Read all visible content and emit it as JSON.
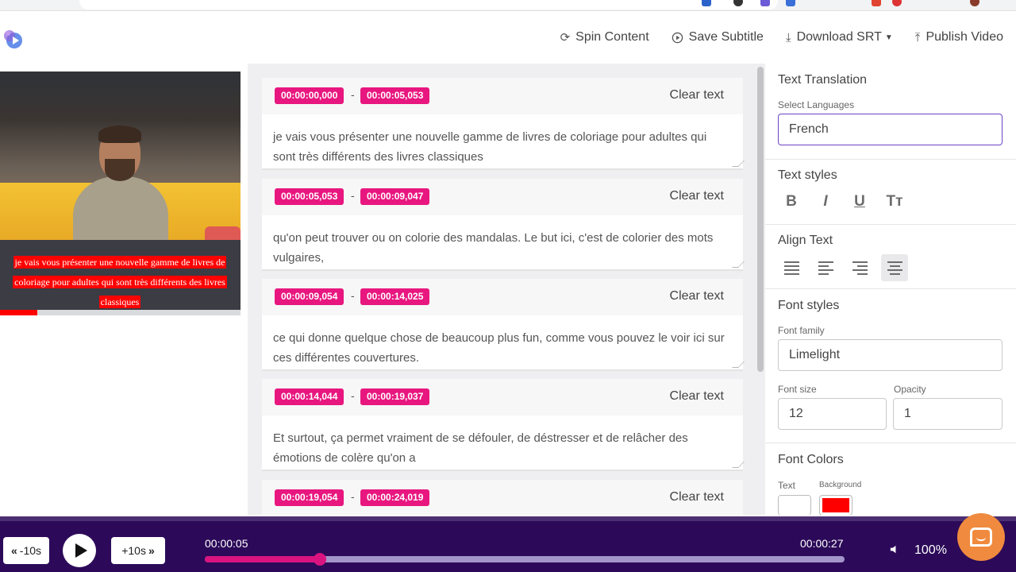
{
  "toolbar": {
    "spin_label": "Spin Content",
    "save_label": "Save Subtitle",
    "download_label": "Download SRT",
    "publish_label": "Publish Video"
  },
  "video": {
    "subtitle_preview": "je vais vous présenter une nouvelle gamme de livres de coloriage pour adultes qui sont très différents des livres classiques",
    "progress_fraction": 0.155
  },
  "subtitles": [
    {
      "start": "00:00:00,000",
      "end": "00:00:05,053",
      "clear_label": "Clear text",
      "text": " je vais vous présenter une nouvelle gamme de livres de coloriage pour adultes qui sont très différents des livres classiques"
    },
    {
      "start": "00:00:05,053",
      "end": "00:00:09,047",
      "clear_label": "Clear text",
      "text": "qu'on peut trouver ou on colorie des mandalas. Le but ici, c'est de colorier des mots vulgaires,"
    },
    {
      "start": "00:00:09,054",
      "end": "00:00:14,025",
      "clear_label": "Clear text",
      "text": "ce qui donne quelque chose de beaucoup plus fun, comme vous pouvez le voir ici sur ces différentes couvertures."
    },
    {
      "start": "00:00:14,044",
      "end": "00:00:19,037",
      "clear_label": "Clear text",
      "text": "Et surtout, ça permet vraiment de se défouler, de déstresser et de relâcher des émotions de colère qu'on a"
    },
    {
      "start": "00:00:19,054",
      "end": "00:00:24,019",
      "clear_label": "Clear text",
      "text": ""
    }
  ],
  "time_separator": "-",
  "panel": {
    "translation_title": "Text Translation",
    "languages_label": "Select Languages",
    "language_value": "French",
    "text_styles_title": "Text styles",
    "bold_glyph": "B",
    "italic_glyph": "I",
    "underline_glyph": "U",
    "case_glyph": "Tт",
    "align_title": "Align Text",
    "align_selected": "center",
    "font_styles_title": "Font styles",
    "font_family_label": "Font family",
    "font_family_value": "Limelight",
    "font_size_label": "Font size",
    "font_size_value": "12",
    "opacity_label": "Opacity",
    "opacity_value": "1",
    "font_colors_title": "Font Colors",
    "text_color_label": "Text",
    "background_color_label": "Background",
    "text_color": "#ffffff",
    "background_color": "#ff0000"
  },
  "player": {
    "rewind_label": "-10s",
    "forward_label": "+10s",
    "current_time": "00:00:05",
    "total_time": "00:00:27",
    "progress_fraction": 0.18,
    "volume_label": "100%"
  },
  "colors": {
    "accent_pink": "#e8177f",
    "player_bg": "#2c0a59",
    "chat_orange": "#f08a3e"
  }
}
